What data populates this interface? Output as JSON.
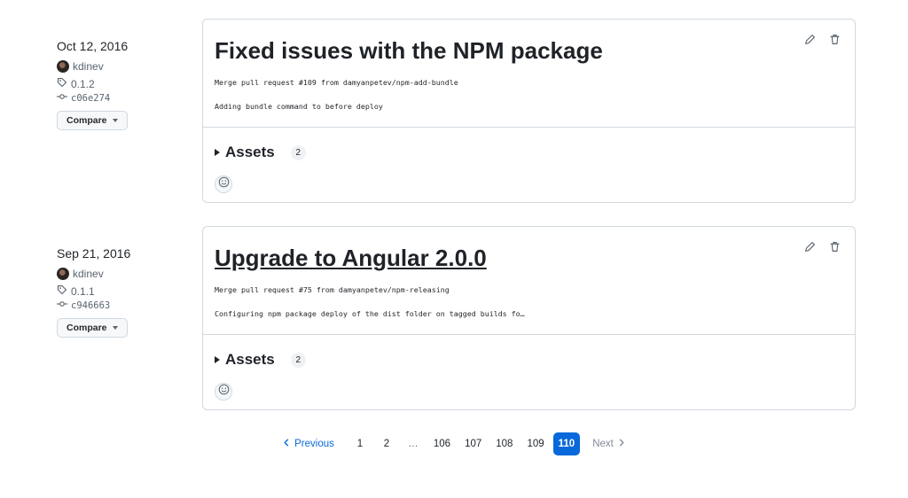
{
  "releases": [
    {
      "date": "Oct 12, 2016",
      "author": "kdinev",
      "tag": "0.1.2",
      "commit": "c06e274",
      "compare_label": "Compare",
      "title": "Fixed issues with the NPM package",
      "title_is_link": false,
      "notes": [
        "Merge pull request #109 from damyanpetev/npm-add-bundle",
        "Adding bundle command to before deploy"
      ],
      "assets_label": "Assets",
      "assets_count": "2"
    },
    {
      "date": "Sep 21, 2016",
      "author": "kdinev",
      "tag": "0.1.1",
      "commit": "c946663",
      "compare_label": "Compare",
      "title": "Upgrade to Angular 2.0.0",
      "title_is_link": true,
      "notes": [
        "Merge pull request #75 from damyanpetev/npm-releasing",
        "Configuring npm package deploy of the dist folder on tagged builds fo…"
      ],
      "assets_label": "Assets",
      "assets_count": "2"
    }
  ],
  "pagination": {
    "previous": "Previous",
    "pages": [
      "1",
      "2",
      "…",
      "106",
      "107",
      "108",
      "109",
      "110"
    ],
    "current": "110",
    "next": "Next"
  },
  "colors": {
    "accent": "#0969da",
    "border": "#d1d9e0",
    "muted": "#59636e"
  },
  "icons": [
    "tag-icon",
    "commit-icon",
    "pencil-icon",
    "trash-icon",
    "smiley-icon",
    "chevron-left-icon",
    "chevron-right-icon",
    "caret-down-icon",
    "triangle-right-icon"
  ]
}
